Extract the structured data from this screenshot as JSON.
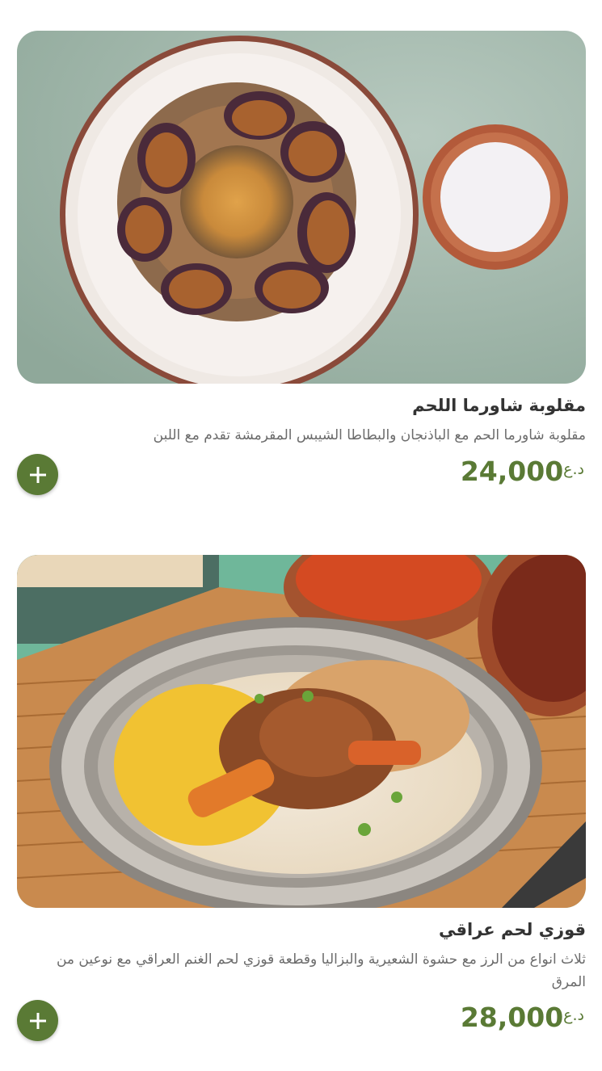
{
  "menu_items": [
    {
      "title": "مقلوبة شاورما اللحم",
      "description": "مقلوبة شاورما الحم مع الباذنجان والبطاطا الشيبس المقرمشة تقدم مع اللبن",
      "price": "24,000",
      "currency": "د.ع",
      "image_icon": "maqluba-dish-image",
      "add_icon": "plus-icon"
    },
    {
      "title": "قوزي لحم عراقي",
      "description": "ثلاث انواع من الرز مع حشوة الشعيرية والبزاليا وقطعة قوزي لحم الغنم العراقي مع نوعين من المرق",
      "price": "28,000",
      "currency": "د.ع",
      "image_icon": "quzi-dish-image",
      "add_icon": "plus-icon"
    }
  ],
  "colors": {
    "accent": "#5a7a35",
    "title": "#333333",
    "description": "#6b6b6b"
  }
}
